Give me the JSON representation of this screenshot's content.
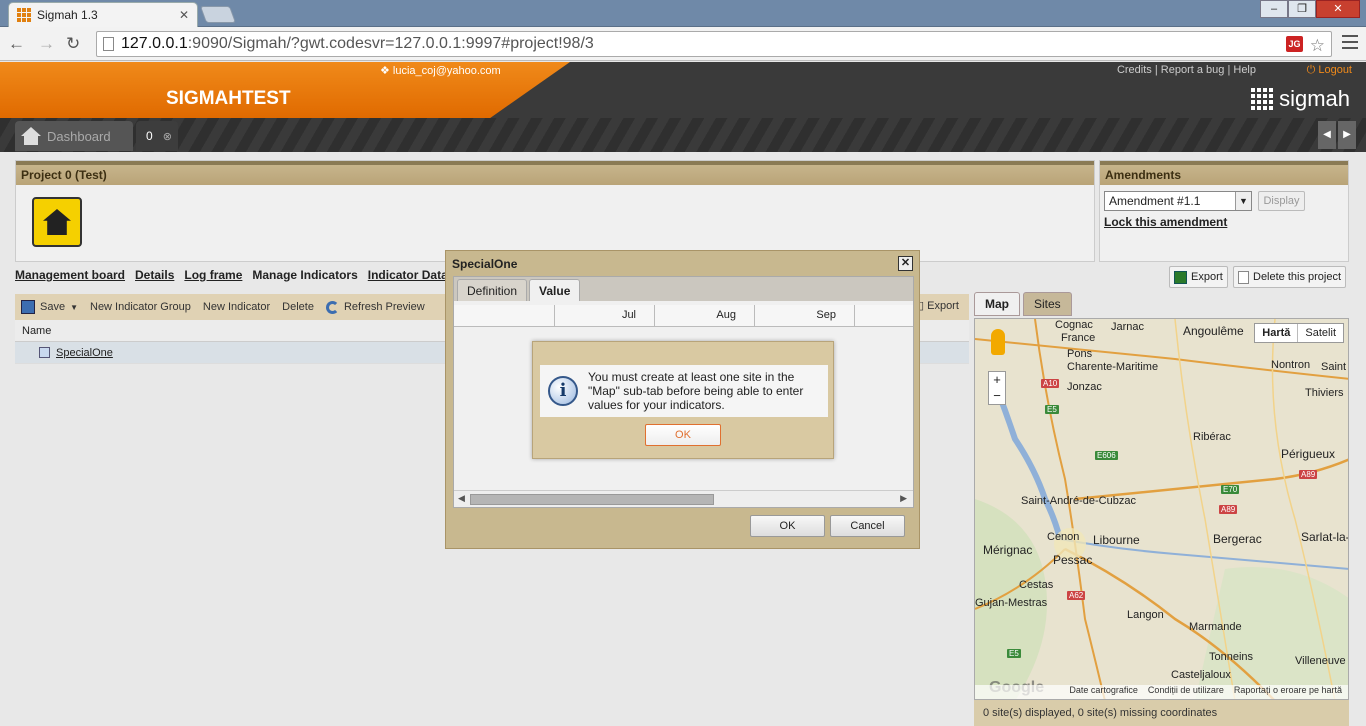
{
  "browser": {
    "tab_title": "Sigmah 1.3",
    "url_host": "127.0.0.1",
    "url_rest": ":9090/Sigmah/?gwt.codesvr=127.0.0.1:9997#project!98/3",
    "extension_badge": "JG"
  },
  "header": {
    "user_email": "lucia_coj@yahoo.com",
    "project_title": "SIGMAHTEST",
    "credits": "Credits",
    "report_bug": "Report a bug",
    "help": "Help",
    "logout": "Logout",
    "logo_text": "sigmah"
  },
  "tabs": {
    "dashboard": "Dashboard",
    "project": "0"
  },
  "project_panel": {
    "title": "Project 0 (Test)"
  },
  "amendments": {
    "title": "Amendments",
    "selected": "Amendment #1.1",
    "display_button": "Display",
    "lock_link": "Lock this amendment"
  },
  "subnav": {
    "items": [
      "Management board",
      "Details",
      "Log frame",
      "Manage Indicators",
      "Indicator Data En"
    ]
  },
  "project_actions": {
    "export": "Export",
    "delete": "Delete this project"
  },
  "indicators": {
    "toolbar": {
      "save": "Save",
      "new_group": "New Indicator Group",
      "new_indicator": "New Indicator",
      "delete": "Delete",
      "refresh": "Refresh Preview",
      "export": "Export"
    },
    "column_name": "Name",
    "rows": [
      "SpecialOne"
    ]
  },
  "dialog": {
    "title": "SpecialOne",
    "tabs": [
      "Definition",
      "Value"
    ],
    "months": [
      "Jul",
      "Aug",
      "Sep"
    ],
    "ok": "OK",
    "cancel": "Cancel"
  },
  "message": {
    "text": "You must create at least one site in the \"Map\" sub-tab before being able to enter values for your indicators.",
    "ok": "OK"
  },
  "map": {
    "tabs": [
      "Map",
      "Sites"
    ],
    "type_map": "Hartă",
    "type_sat": "Satelit",
    "labels": [
      "Cognac",
      "Jarnac",
      "Angoulême",
      "France",
      "Pons",
      "Charente-Maritime",
      "Nontron",
      "Jonzac",
      "Thiviers",
      "Ribérac",
      "Périgueux",
      "Saint-André-de-Cubzac",
      "Mérignac",
      "Cenon",
      "Libourne",
      "Bergerac",
      "Pessac",
      "Cestas",
      "Gujan-Mestras",
      "Langon",
      "Marmande",
      "Tonneins",
      "Villeneuve",
      "Casteljaloux",
      "Sarlat-la-Ca",
      "Saint"
    ],
    "roads": [
      "A10",
      "E5",
      "E606",
      "A89",
      "E70",
      "A89",
      "A62",
      "E5"
    ],
    "footer": [
      "Date cartografice",
      "Condiții de utilizare",
      "Raportați o eroare pe hartă"
    ],
    "google": "Google",
    "status": "0 site(s) displayed, 0 site(s) missing coordinates",
    "zoom_in": "+",
    "zoom_out": "−"
  }
}
